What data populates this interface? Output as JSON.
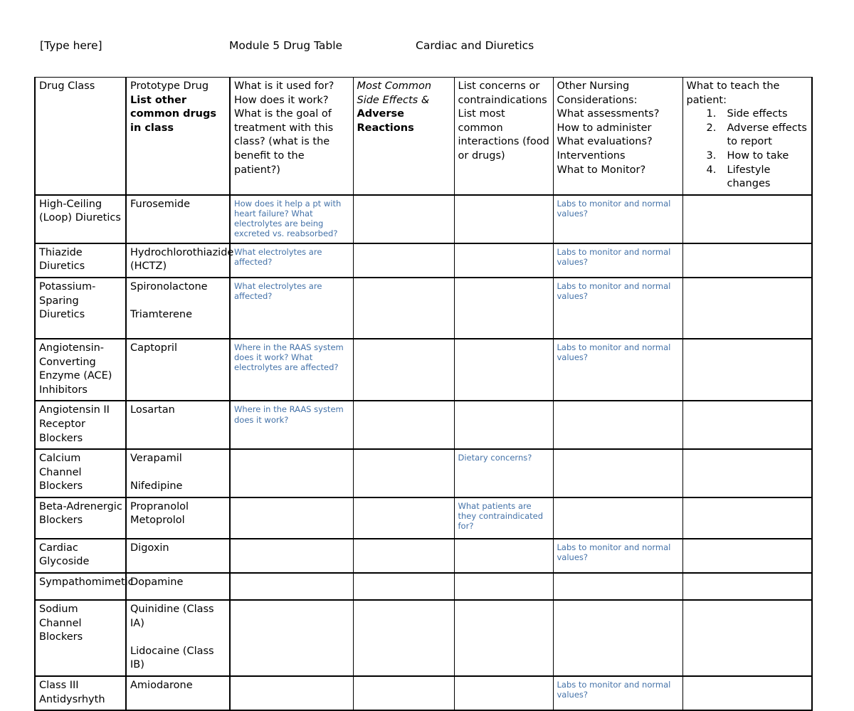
{
  "header": {
    "type_here": "[Type here]",
    "title": "Module 5 Drug Table",
    "topic": "Cardiac and Diuretics"
  },
  "table": {
    "columns": [
      {
        "key": "drug_class",
        "label": "Drug Class"
      },
      {
        "key": "prototype",
        "label_plain": "Prototype Drug",
        "label_bold": "List other common drugs in class"
      },
      {
        "key": "use",
        "lines": [
          "What is it used for?",
          "How does it work?",
          "What is the goal of treatment with this class? (what is the benefit to the patient?)"
        ]
      },
      {
        "key": "side_effects",
        "label_italic": "Most Common Side Effects &",
        "label_bold": "Adverse Reactions"
      },
      {
        "key": "concerns",
        "lines": [
          "List concerns or contraindications",
          "List most common interactions (food or drugs)"
        ]
      },
      {
        "key": "nursing",
        "lines": [
          "Other Nursing Considerations:",
          "What assessments?",
          "How to administer",
          "What evaluations?",
          "Interventions",
          "What to Monitor?"
        ]
      },
      {
        "key": "teach",
        "label": "What to teach the patient:",
        "list": [
          {
            "num": "1.",
            "text": "Side effects"
          },
          {
            "num": "2.",
            "text": "Adverse effects to report"
          },
          {
            "num": "3.",
            "text": "How to take"
          },
          {
            "num": "4.",
            "text": "Lifestyle changes"
          }
        ]
      }
    ],
    "rows": [
      {
        "id": "loop-diuretics",
        "drug_class": "High-Ceiling (Loop) Diuretics",
        "prototype": "Furosemide",
        "prototype_2": "",
        "use_note": "How does it help a pt with heart failure? What electrolytes are being excreted vs. reabsorbed?",
        "side_effects": "",
        "concerns_note": "",
        "nursing_note": "Labs to monitor and normal values?",
        "teach": ""
      },
      {
        "id": "thiazide-diuretics",
        "drug_class": "Thiazide Diuretics",
        "prototype": "Hydrochlorothiazide (HCTZ)",
        "prototype_2": "",
        "use_note": "What electrolytes are affected?",
        "side_effects": "",
        "concerns_note": "",
        "nursing_note": "Labs to monitor and normal values?",
        "teach": ""
      },
      {
        "id": "potassium-sparing-diuretics",
        "drug_class": "Potassium-Sparing Diuretics",
        "prototype": "Spironolactone",
        "prototype_2": "Triamterene",
        "use_note": "What electrolytes are affected?",
        "side_effects": "",
        "concerns_note": "",
        "nursing_note": "Labs to monitor and normal values?",
        "teach": ""
      },
      {
        "id": "ace-inhibitors",
        "drug_class": "Angiotensin-Converting Enzyme (ACE) Inhibitors",
        "prototype": "Captopril",
        "prototype_2": "",
        "use_note": "Where in the RAAS system does it work? What electrolytes are affected?",
        "side_effects": "",
        "concerns_note": "",
        "nursing_note": "Labs to monitor and normal values?",
        "teach": ""
      },
      {
        "id": "arbs",
        "drug_class": "Angiotensin II Receptor Blockers",
        "prototype": "Losartan",
        "prototype_2": "",
        "use_note": "Where in the RAAS system does it work?",
        "side_effects": "",
        "concerns_note": "",
        "nursing_note": "",
        "teach": ""
      },
      {
        "id": "calcium-channel-blockers",
        "drug_class": "Calcium Channel Blockers",
        "prototype": "Verapamil",
        "prototype_2": "Nifedipine",
        "use_note": "",
        "side_effects": "",
        "concerns_note": "Dietary concerns?",
        "nursing_note": "",
        "teach": ""
      },
      {
        "id": "beta-adrenergic-blockers",
        "drug_class": "Beta-Adrenergic Blockers",
        "prototype": "Propranolol",
        "prototype_2_inline": "Metoprolol",
        "prototype_2": "",
        "use_note": "",
        "side_effects": "",
        "concerns_note": "What patients are they contraindicated for?",
        "nursing_note": "",
        "teach": ""
      },
      {
        "id": "cardiac-glycoside",
        "drug_class": "Cardiac Glycoside",
        "prototype": "Digoxin",
        "prototype_2": "",
        "use_note": "",
        "side_effects": "",
        "concerns_note": "",
        "nursing_note": "Labs to monitor and normal values?",
        "teach": ""
      },
      {
        "id": "sympathomimetic",
        "drug_class": "Sympathomimetic",
        "prototype": "Dopamine",
        "prototype_2": "",
        "use_note": "",
        "side_effects": "",
        "concerns_note": "",
        "nursing_note": "",
        "teach": ""
      },
      {
        "id": "sodium-channel-blockers",
        "drug_class": "Sodium Channel Blockers",
        "prototype": "Quinidine (Class IA)",
        "prototype_2": "Lidocaine (Class IB)",
        "use_note": "",
        "side_effects": "",
        "concerns_note": "",
        "nursing_note": "",
        "teach": ""
      },
      {
        "id": "class-iii-antidysrhythmics",
        "drug_class": "Class III Antidysrhyth",
        "prototype": "Amiodarone",
        "prototype_2": "",
        "use_note": "",
        "side_effects": "",
        "concerns_note": "",
        "nursing_note": "Labs to monitor and normal values?",
        "teach": ""
      }
    ]
  },
  "colors": {
    "note_blue": "#4472a8",
    "border": "#000000",
    "text": "#000000"
  }
}
